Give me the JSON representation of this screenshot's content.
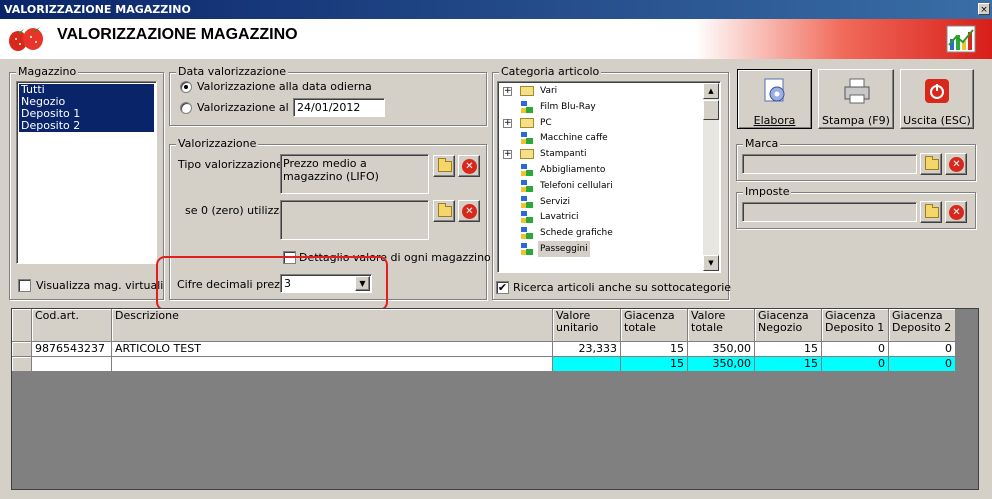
{
  "window": {
    "title": "VALORIZZAZIONE MAGAZZINO",
    "header_title": "VALORIZZAZIONE MAGAZZINO",
    "close_glyph": "×"
  },
  "magazzino": {
    "legend": "Magazzino",
    "items": [
      "Tutti",
      "Negozio",
      "Deposito 1",
      "Deposito 2"
    ],
    "virtual_label": "Visualizza mag. virtuali",
    "virtual_checked": false
  },
  "data_val": {
    "legend": "Data valorizzazione",
    "option_today": "Valorizzazione alla data odierna",
    "option_at": "Valorizzazione al",
    "date_value": "24/01/2012",
    "selected": "today"
  },
  "valorizzazione": {
    "legend": "Valorizzazione",
    "tipo_label": "Tipo valorizzazione :",
    "tipo_value": "Prezzo medio a magazzino (LIFO)",
    "zero_label": "se 0 (zero) utilizza :",
    "zero_value": "",
    "dettaglio_label": "Dettaglio valore di ogni magazzino",
    "dettaglio_checked": false,
    "cifre_label": "Cifre decimali prezzi :",
    "cifre_value": "3"
  },
  "categoria": {
    "legend": "Categoria articolo",
    "tree": [
      {
        "label": "Vari",
        "type": "folder",
        "expander": "+"
      },
      {
        "label": "Film Blu-Ray",
        "type": "item"
      },
      {
        "label": "PC",
        "type": "folder",
        "expander": "+"
      },
      {
        "label": "Macchine caffe",
        "type": "item"
      },
      {
        "label": "Stampanti",
        "type": "folder",
        "expander": "+"
      },
      {
        "label": "Abbigliamento",
        "type": "item"
      },
      {
        "label": "Telefoni cellulari",
        "type": "item"
      },
      {
        "label": "Servizi",
        "type": "item"
      },
      {
        "label": "Lavatrici",
        "type": "item"
      },
      {
        "label": "Schede grafiche",
        "type": "item"
      },
      {
        "label": "Passeggini",
        "type": "item",
        "selected": true
      }
    ],
    "sub_label": "Ricerca articoli anche su sottocategorie",
    "sub_checked": true
  },
  "toolbar": {
    "elabora": "Elabora",
    "stampa": "Stampa (F9)",
    "uscita": "Uscita (ESC)"
  },
  "marca": {
    "legend": "Marca",
    "value": ""
  },
  "imposte": {
    "legend": "Imposte",
    "value": ""
  },
  "grid": {
    "columns": [
      {
        "l1": "Cod.art.",
        "l2": ""
      },
      {
        "l1": "Descrizione",
        "l2": ""
      },
      {
        "l1": "Valore",
        "l2": "unitario"
      },
      {
        "l1": "Giacenza",
        "l2": "totale"
      },
      {
        "l1": "Valore totale",
        "l2": ""
      },
      {
        "l1": "Giacenza",
        "l2": "Negozio"
      },
      {
        "l1": "Giacenza",
        "l2": "Deposito 1"
      },
      {
        "l1": "Giacenza",
        "l2": "Deposito 2"
      }
    ],
    "rows": [
      [
        "9876543237",
        "ARTICOLO TEST",
        "23,333",
        "15",
        "350,00",
        "15",
        "0",
        "0"
      ]
    ],
    "totals": [
      "",
      "",
      "",
      "15",
      "350,00",
      "15",
      "0",
      "0"
    ]
  },
  "colors": {
    "highlight_ring": "#e02020",
    "selection": "#0a246a",
    "totals_row": "#00ffff"
  }
}
